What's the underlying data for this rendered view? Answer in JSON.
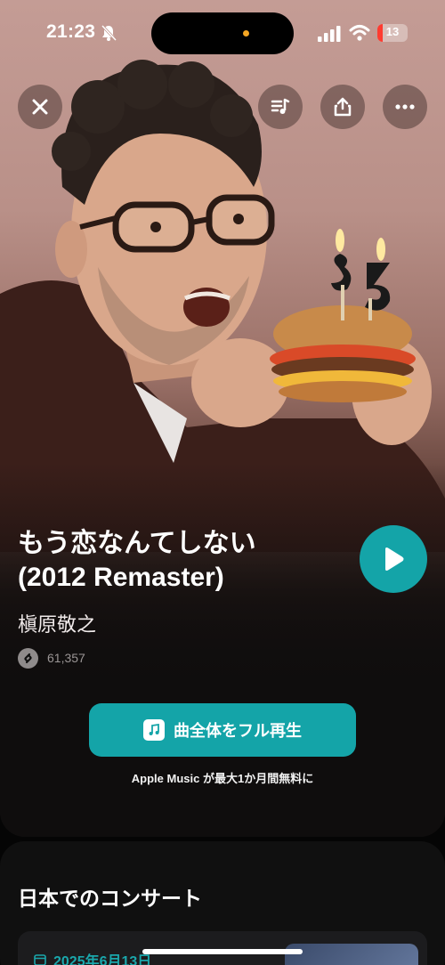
{
  "status_bar": {
    "time": "21:23",
    "battery_level": "13"
  },
  "colors": {
    "accent": "#14a4a8",
    "battery_low": "#ff3b30",
    "island_indicator": "#f5a623"
  },
  "top_buttons": {
    "close": "close-icon",
    "queue": "queue-music-icon",
    "share": "share-icon",
    "more": "ellipsis-icon"
  },
  "song": {
    "title_line1": "もう恋なんてしない",
    "title_line2": "(2012 Remaster)",
    "artist": "槇原敬之",
    "shazam_count": "61,357"
  },
  "actions": {
    "full_play_label": "曲全体をフル再生",
    "apple_music_note": "Apple Music が最大1か月間無料に"
  },
  "concerts": {
    "heading": "日本でのコンサート",
    "items": [
      {
        "date": "2025年6月13日"
      }
    ]
  }
}
